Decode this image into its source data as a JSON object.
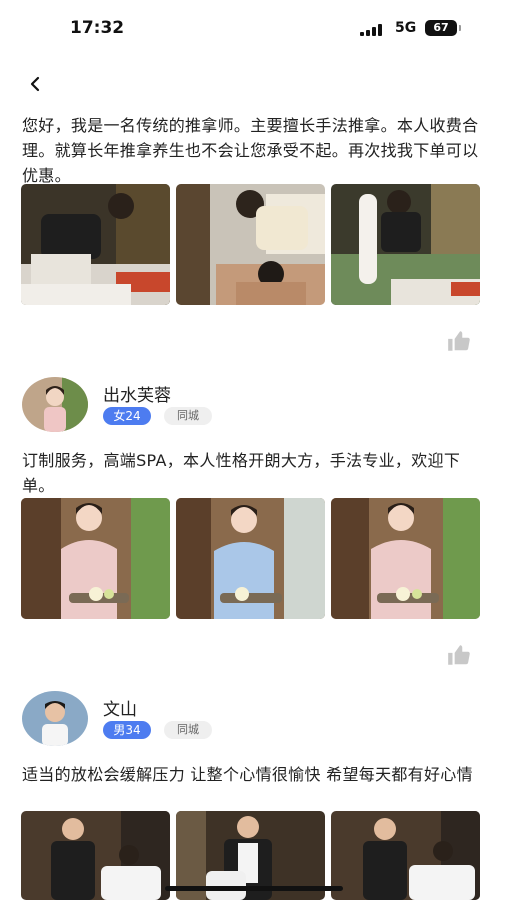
{
  "status_bar": {
    "time": "17:32",
    "network": "5G",
    "battery": "67"
  },
  "posts": [
    {
      "text": "您好，我是一名传统的推拿师。主要擅长手法推拿。本人收费合理。就算长年推拿养生也不会让您承受不起。再次找我下单可以优惠。",
      "photos": [
        "massage-photo-1",
        "massage-photo-2",
        "massage-photo-3"
      ],
      "like_icon": "thumbs-up-icon"
    },
    {
      "user": {
        "name": "出水芙蓉",
        "gender_age": "女24",
        "location": "同城"
      },
      "text": "订制服务，高端SPA，本人性格开朗大方，手法专业，欢迎下单。",
      "photos": [
        "spa-photo-1",
        "spa-photo-2",
        "spa-photo-3"
      ],
      "like_icon": "thumbs-up-icon"
    },
    {
      "user": {
        "name": "文山",
        "gender_age": "男34",
        "location": "同城"
      },
      "text": "适当的放松会缓解压力 让整个心情很愉快 希望每天都有好心情",
      "photos": [
        "stretch-photo-1",
        "stretch-photo-2",
        "stretch-photo-3"
      ]
    }
  ],
  "colors": {
    "accent": "#4d7cf0",
    "tag_gray": "#efefef"
  }
}
